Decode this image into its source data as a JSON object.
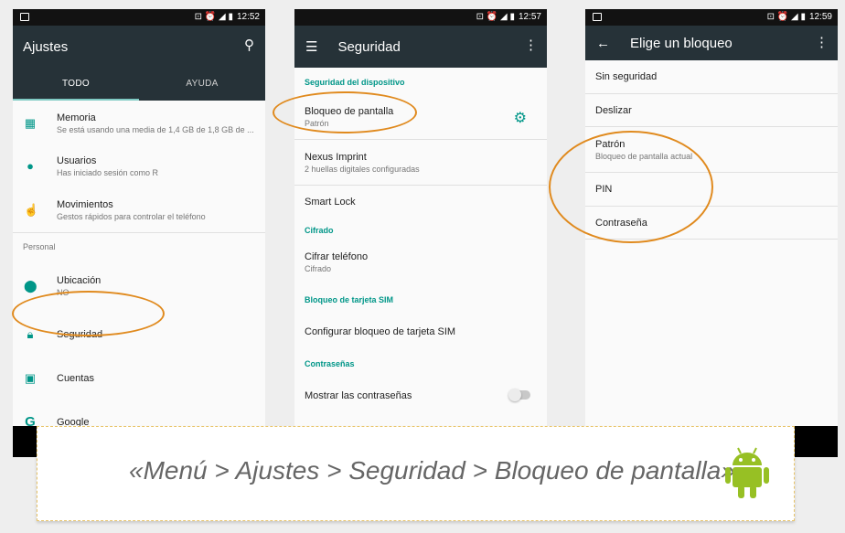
{
  "screen1": {
    "time": "12:52",
    "title": "Ajustes",
    "tabs": [
      "TODO",
      "AYUDA"
    ],
    "items": [
      {
        "title": "Memoria",
        "subtitle": "Se está usando una media de 1,4 GB de 1,8 GB de ...",
        "icon": "memory-icon"
      },
      {
        "title": "Usuarios",
        "subtitle": "Has iniciado sesión como R",
        "icon": "person-icon"
      },
      {
        "title": "Movimientos",
        "subtitle": "Gestos rápidos para controlar el teléfono",
        "icon": "gesture-icon"
      }
    ],
    "section_personal": "Personal",
    "personal_items": [
      {
        "title": "Ubicación",
        "subtitle": "NO",
        "icon": "location-icon"
      },
      {
        "title": "Seguridad",
        "subtitle": "",
        "icon": "lock-icon"
      },
      {
        "title": "Cuentas",
        "subtitle": "",
        "icon": "account-icon"
      },
      {
        "title": "Google",
        "subtitle": "",
        "icon": "google-icon"
      }
    ]
  },
  "screen2": {
    "time": "12:57",
    "title": "Seguridad",
    "cat_device": "Seguridad del dispositivo",
    "screen_lock": {
      "title": "Bloqueo de pantalla",
      "subtitle": "Patrón"
    },
    "nexus": {
      "title": "Nexus Imprint",
      "subtitle": "2 huellas digitales configuradas"
    },
    "smart_lock": "Smart Lock",
    "cat_encrypt": "Cifrado",
    "encrypt": {
      "title": "Cifrar teléfono",
      "subtitle": "Cifrado"
    },
    "cat_sim": "Bloqueo de tarjeta SIM",
    "sim_config": "Configurar bloqueo de tarjeta SIM",
    "cat_passwords": "Contraseñas",
    "show_passwords": "Mostrar las contraseñas"
  },
  "screen3": {
    "time": "12:59",
    "title": "Elige un bloqueo",
    "options": [
      {
        "title": "Sin seguridad",
        "subtitle": ""
      },
      {
        "title": "Deslizar",
        "subtitle": ""
      },
      {
        "title": "Patrón",
        "subtitle": "Bloqueo de pantalla actual"
      },
      {
        "title": "PIN",
        "subtitle": ""
      },
      {
        "title": "Contraseña",
        "subtitle": ""
      }
    ]
  },
  "banner": {
    "text": "«Menú > Ajustes > Seguridad > Bloqueo de pantalla»",
    "icon": "android-robot-icon"
  },
  "colors": {
    "toolbar": "#263238",
    "accent": "#009688",
    "highlight": "#e08a1e"
  }
}
